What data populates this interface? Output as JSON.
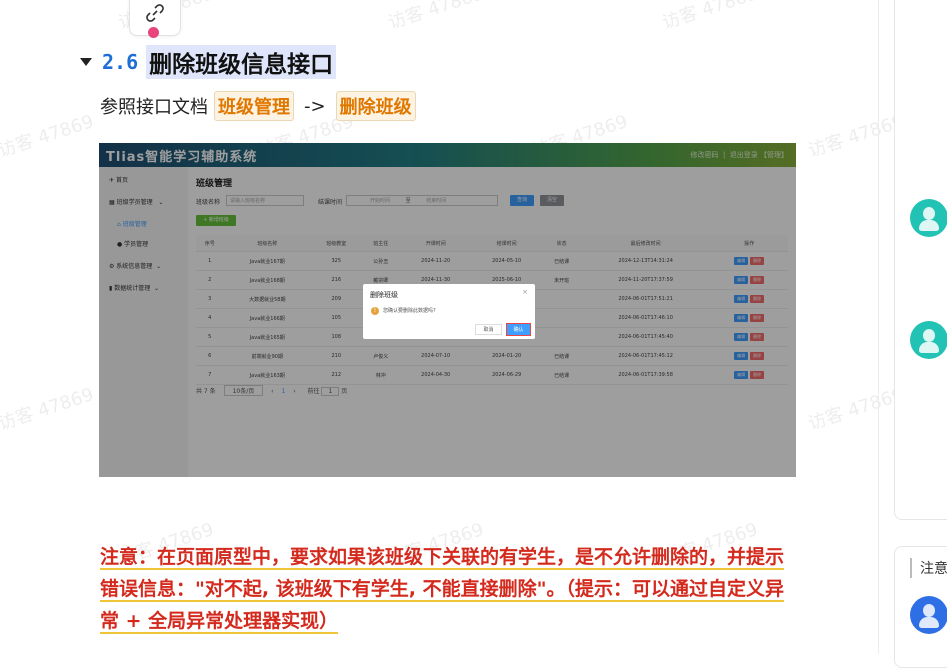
{
  "heading": {
    "number": "2.6",
    "title": "删除班级信息接口"
  },
  "reference": {
    "prefix": "参照接口文档",
    "tag1": "班级管理",
    "arrow": "->",
    "tag2": "删除班级"
  },
  "screenshot": {
    "app_title": "Tlias智能学习辅助系统",
    "top_right": {
      "change_password": "修改密码",
      "separator": "|",
      "logout": "退出登录 【管理】"
    },
    "sidebar": [
      "首页",
      "班级学员管理",
      "班级管理",
      "学员管理",
      "系统信息管理",
      "数据统计管理"
    ],
    "page_title": "班级管理",
    "filters": {
      "name_label": "班级名称",
      "name_placeholder": "请输入班级名称",
      "time_label": "结课时间",
      "start_placeholder": "开始时间",
      "to": "至",
      "end_placeholder": "结束时间",
      "search": "查询",
      "clear": "清空"
    },
    "add_button": "+ 新增班级",
    "columns": [
      "序号",
      "班级名称",
      "班级教室",
      "班主任",
      "开课时间",
      "结课时间",
      "状态",
      "最后修改时间",
      "操作"
    ],
    "rows": [
      [
        "1",
        "Java就业167期",
        "325",
        "公孙丑",
        "2024-11-20",
        "2024-05-10",
        "已结课",
        "2024-12-13T14:31:24"
      ],
      [
        "2",
        "Java就业168期",
        "216",
        "戴宗卿",
        "2024-11-30",
        "2025-06-10",
        "未开班",
        "2024-11-20T17:37:59"
      ],
      [
        "3",
        "大数据就业58期",
        "209",
        "",
        "",
        "",
        "",
        "2024-06-01T17:51:21"
      ],
      [
        "4",
        "Java就业166期",
        "105",
        "",
        "",
        "",
        "",
        "2024-06-01T17:46:10"
      ],
      [
        "5",
        "Java就业165期",
        "108",
        "",
        "",
        "",
        "",
        "2024-06-01T17:45:40"
      ],
      [
        "6",
        "前端就业90期",
        "210",
        "卢俊义",
        "2024-07-10",
        "2024-01-20",
        "已结课",
        "2024-06-01T17:45:12"
      ],
      [
        "7",
        "Java就业163期",
        "212",
        "林冲",
        "2024-04-30",
        "2024-06-29",
        "已结课",
        "2024-06-01T17:39:58"
      ]
    ],
    "edit_label": "编辑",
    "delete_label": "删除",
    "pager": {
      "total": "共 7 条",
      "size": "10条/页",
      "page": "1",
      "goto": "前往",
      "goto_page": "1",
      "page_suffix": "页"
    },
    "dialog": {
      "title": "删除班级",
      "close": "×",
      "message": "您确认要删除此数据吗?",
      "cancel": "取消",
      "confirm": "确认"
    }
  },
  "note": {
    "text": "注意：在页面原型中，要求如果该班级下关联的有学生，是不允许删除的，并提示错误信息：\"对不起, 该班级下有学生, 不能直接删除\"。（提示：可以通过自定义异常 + 全局异常处理器实现）"
  },
  "right_panel": {
    "note_label": "注意"
  },
  "watermark": "访客 47869",
  "colors": {
    "tag_text": "#e07800",
    "note_text": "#d42a1e",
    "heading_number": "#1d6fd6",
    "avatar_teal": "#22c3b4",
    "avatar_blue": "#2f6fe6"
  }
}
